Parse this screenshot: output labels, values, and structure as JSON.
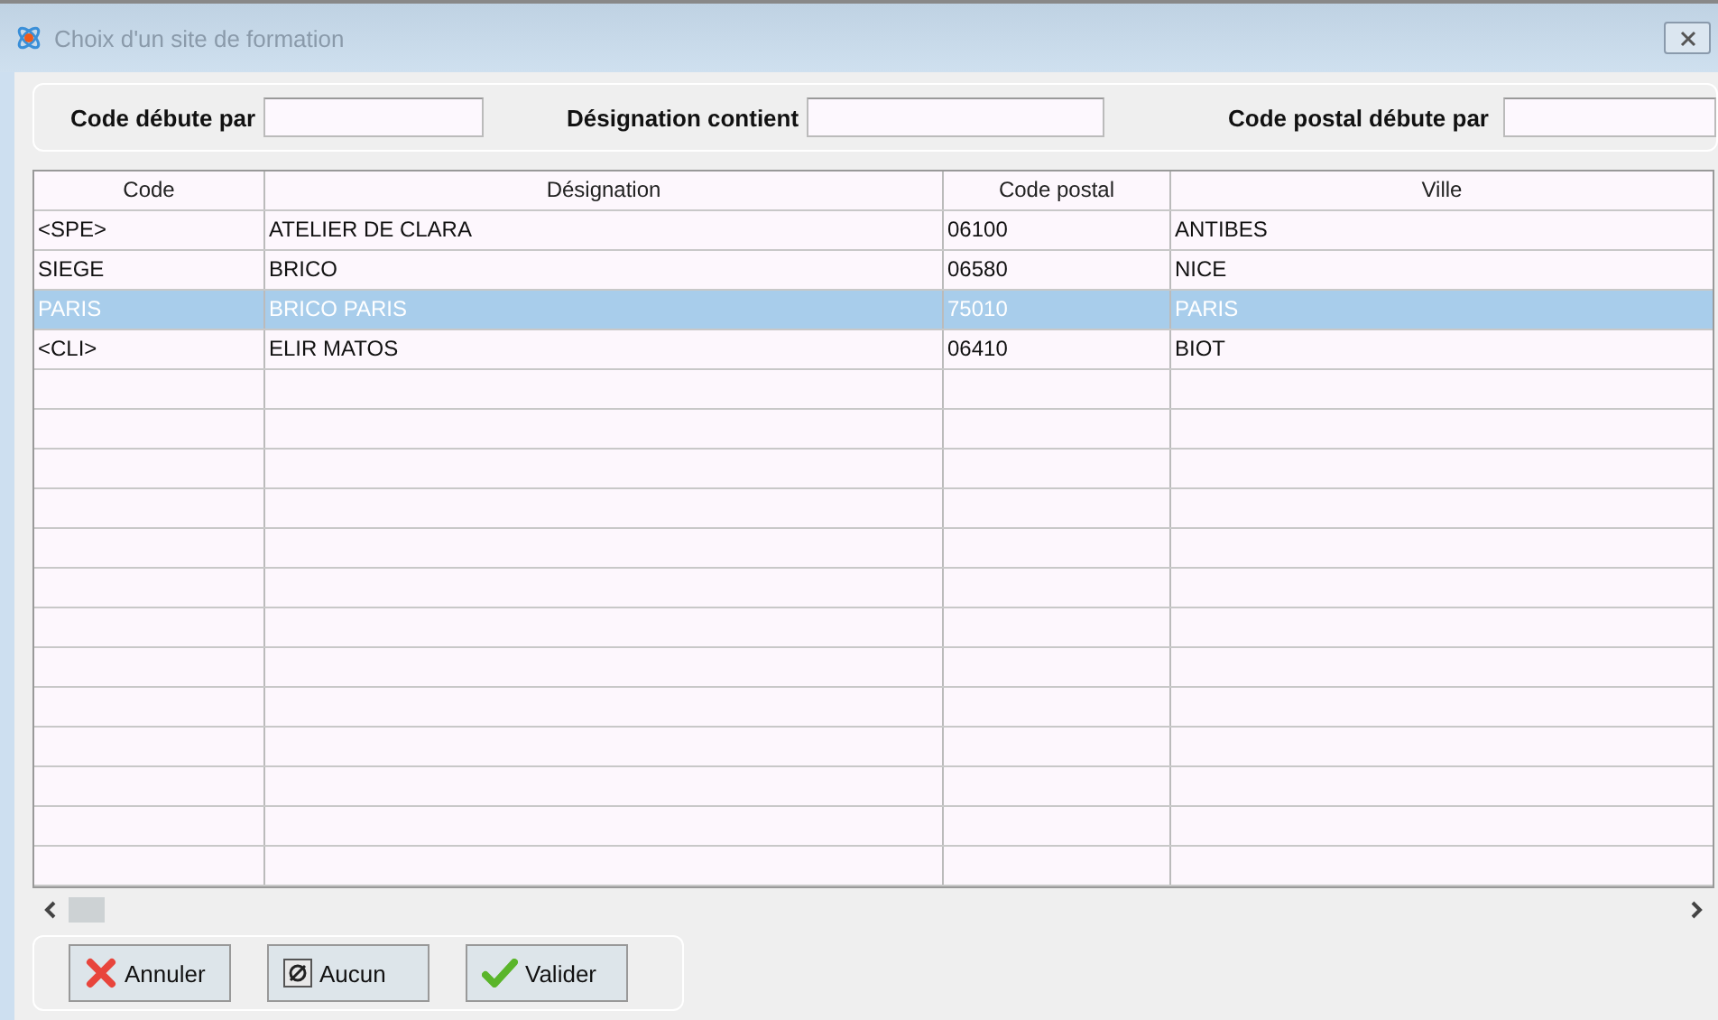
{
  "window": {
    "title": "Choix d'un site de formation"
  },
  "filters": [
    {
      "label": "Code débute par"
    },
    {
      "label": "Désignation contient"
    },
    {
      "label": "Code postal débute par"
    }
  ],
  "table": {
    "columns": [
      "Code",
      "Désignation",
      "Code postal",
      "Ville"
    ],
    "rows": [
      {
        "cells": [
          "<SPE>",
          "ATELIER DE CLARA",
          "06100",
          "ANTIBES"
        ],
        "selected": false
      },
      {
        "cells": [
          "SIEGE",
          "BRICO",
          "06580",
          "NICE"
        ],
        "selected": false
      },
      {
        "cells": [
          "PARIS",
          "BRICO PARIS",
          "75010",
          "PARIS"
        ],
        "selected": true
      },
      {
        "cells": [
          "<CLI>",
          "ELIR MATOS",
          "06410",
          "BIOT"
        ],
        "selected": false
      }
    ]
  },
  "buttons": [
    {
      "label": "Annuler",
      "kind": "cancel"
    },
    {
      "label": "Aucun",
      "kind": "none"
    },
    {
      "label": "Valider",
      "kind": "ok"
    }
  ]
}
